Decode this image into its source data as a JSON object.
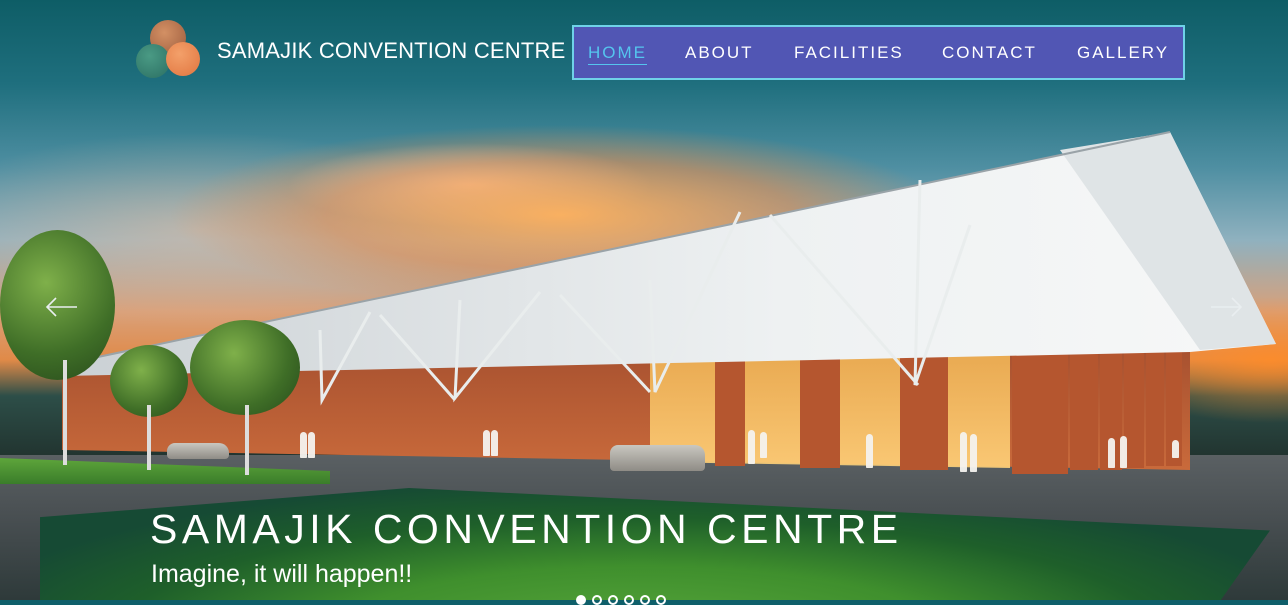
{
  "brand": {
    "name": "SAMAJIK CONVENTION CENTRE",
    "logo_icon": "three-circles-logo-icon"
  },
  "nav": {
    "items": [
      {
        "label": "HOME",
        "active": true
      },
      {
        "label": "ABOUT",
        "active": false
      },
      {
        "label": "FACILITIES",
        "active": false
      },
      {
        "label": "CONTACT",
        "active": false
      },
      {
        "label": "GALLERY",
        "active": false
      }
    ]
  },
  "hero": {
    "title": "SAMAJIK CONVENTION CENTRE",
    "tagline": "Imagine, it will happen!!",
    "prev_icon": "arrow-left-icon",
    "next_icon": "arrow-right-icon",
    "slide_count": 6,
    "active_slide": 1
  },
  "colors": {
    "nav_bg": "#5156b4",
    "nav_border": "#6fd2e8",
    "nav_active": "#55c5ee",
    "text": "#ffffff"
  }
}
